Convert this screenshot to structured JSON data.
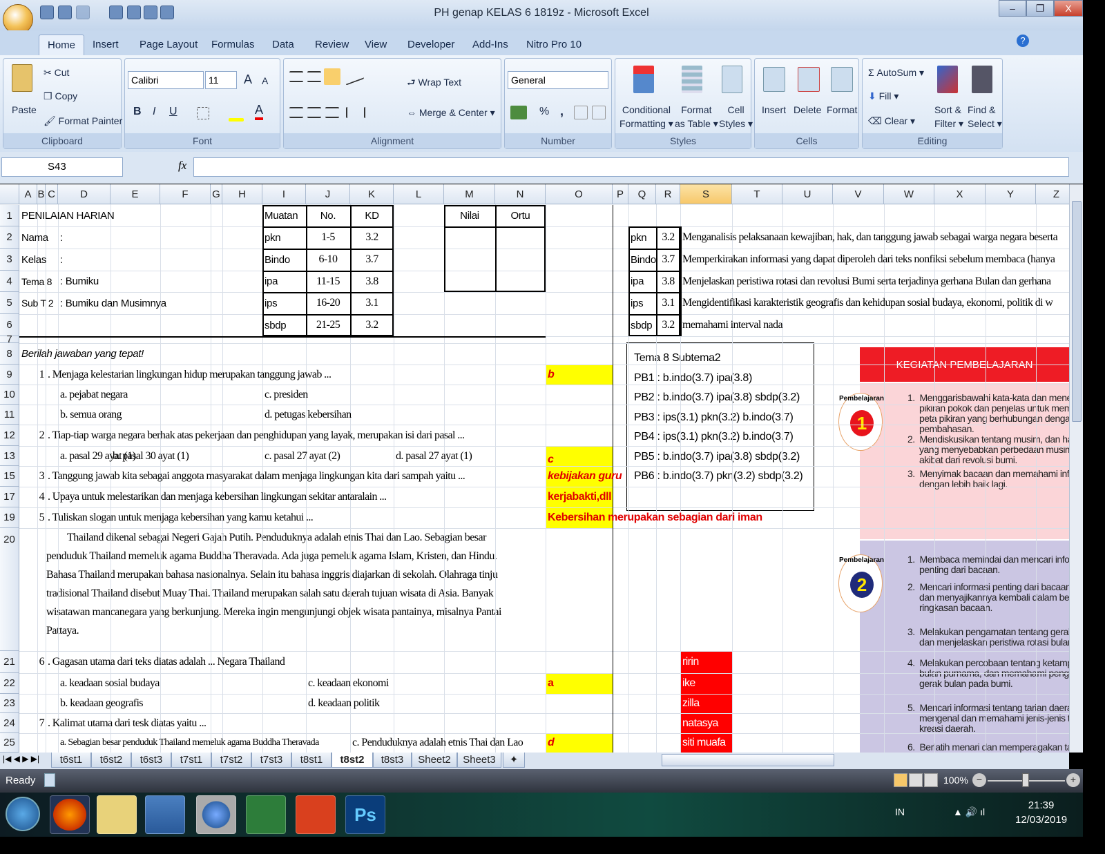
{
  "window": {
    "title": "PH genap KELAS 6 1819z - Microsoft Excel",
    "controls": [
      "–",
      "❐",
      "X"
    ]
  },
  "tabs": [
    {
      "label": "Home",
      "active": true
    },
    {
      "label": "Insert"
    },
    {
      "label": "Page Layout"
    },
    {
      "label": "Formulas"
    },
    {
      "label": "Data"
    },
    {
      "label": "Review"
    },
    {
      "label": "View"
    },
    {
      "label": "Developer"
    },
    {
      "label": "Add-Ins"
    },
    {
      "label": "Nitro Pro 10"
    }
  ],
  "ribbon": {
    "clipboard": {
      "label": "Clipboard",
      "paste": "Paste",
      "cut": "Cut",
      "copy": "Copy",
      "format_painter": "Format Painter"
    },
    "font": {
      "label": "Font",
      "name": "Calibri",
      "size": "11",
      "bold": "B",
      "italic": "I",
      "underline": "U",
      "grow": "A",
      "shrink": "A",
      "color": "A"
    },
    "alignment": {
      "label": "Alignment",
      "wrap": "Wrap Text",
      "merge": "Merge & Center"
    },
    "number": {
      "label": "Number",
      "format": "General",
      "percent": "%",
      "comma": ","
    },
    "styles": {
      "label": "Styles",
      "conditional": "Conditional",
      "conditional2": "Formatting",
      "format_table": "Format",
      "format_table2": "as Table",
      "cell_styles": "Cell",
      "cell_styles2": "Styles"
    },
    "cells": {
      "label": "Cells",
      "insert": "Insert",
      "delete": "Delete",
      "format": "Format"
    },
    "editing": {
      "label": "Editing",
      "autosum": "AutoSum",
      "fill": "Fill",
      "clear": "Clear",
      "sort": "Sort &",
      "sort2": "Filter",
      "find": "Find &",
      "find2": "Select"
    }
  },
  "formula_bar": {
    "name_box": "S43",
    "fx": "fx",
    "value": ""
  },
  "columns": [
    "A",
    "B",
    "C",
    "D",
    "E",
    "F",
    "G",
    "H",
    "I",
    "J",
    "K",
    "L",
    "M",
    "N",
    "O",
    "P",
    "Q",
    "R",
    "S",
    "T",
    "U",
    "V",
    "W",
    "X",
    "Y",
    "Z"
  ],
  "selected_column": "S",
  "rows": [
    "1",
    "2",
    "3",
    "4",
    "5",
    "6",
    "7",
    "8",
    "9",
    "10",
    "11",
    "12",
    "13",
    "15",
    "17",
    "19",
    "20",
    "21",
    "22",
    "23",
    "24",
    "25"
  ],
  "cells": [
    {
      "c": "A",
      "r": "1",
      "v": "PENILAIAN HARIAN",
      "s": "sans"
    },
    {
      "c": "I",
      "r": "1",
      "v": "Muatan",
      "s": "sans"
    },
    {
      "c": "J",
      "r": "1",
      "v": "No.",
      "s": "sans center"
    },
    {
      "c": "K",
      "r": "1",
      "v": "KD",
      "s": "sans center"
    },
    {
      "c": "M",
      "r": "1",
      "v": "Nilai",
      "s": "sans center"
    },
    {
      "c": "N",
      "r": "1",
      "v": "Ortu",
      "s": "sans center"
    },
    {
      "c": "A",
      "r": "2",
      "v": "Nama",
      "s": "sans"
    },
    {
      "c": "D",
      "r": "2",
      "v": ":",
      "s": "sans"
    },
    {
      "c": "I",
      "r": "2",
      "v": "pkn",
      "s": "sans"
    },
    {
      "c": "J",
      "r": "2",
      "v": "1-5",
      "s": "center"
    },
    {
      "c": "K",
      "r": "2",
      "v": "3.2",
      "s": "center"
    },
    {
      "c": "Q",
      "r": "2",
      "v": "pkn",
      "s": "sans"
    },
    {
      "c": "R",
      "r": "2",
      "v": "3.2",
      "s": "center"
    },
    {
      "c": "S",
      "r": "2",
      "v": "Menganalisis pelaksanaan kewajiban, hak, dan tanggung jawab sebagai warga negara beserta"
    },
    {
      "c": "A",
      "r": "3",
      "v": "Kelas",
      "s": "sans"
    },
    {
      "c": "D",
      "r": "3",
      "v": ":",
      "s": "sans"
    },
    {
      "c": "I",
      "r": "3",
      "v": "Bindo",
      "s": "sans"
    },
    {
      "c": "J",
      "r": "3",
      "v": "6-10",
      "s": "center"
    },
    {
      "c": "K",
      "r": "3",
      "v": "3.7",
      "s": "center"
    },
    {
      "c": "Q",
      "r": "3",
      "v": "Bindo",
      "s": "sans clip"
    },
    {
      "c": "R",
      "r": "3",
      "v": "3.7",
      "s": "center"
    },
    {
      "c": "S",
      "r": "3",
      "v": "Memperkirakan informasi yang dapat diperoleh dari teks nonfiksi sebelum membaca (hanya"
    },
    {
      "c": "A",
      "r": "4",
      "v": "Tema 8",
      "s": "sans small"
    },
    {
      "c": "D",
      "r": "4",
      "v": ": Bumiku",
      "s": "sans"
    },
    {
      "c": "I",
      "r": "4",
      "v": "ipa",
      "s": "sans"
    },
    {
      "c": "J",
      "r": "4",
      "v": "11-15",
      "s": "center"
    },
    {
      "c": "K",
      "r": "4",
      "v": "3.8",
      "s": "center"
    },
    {
      "c": "Q",
      "r": "4",
      "v": "ipa",
      "s": "sans"
    },
    {
      "c": "R",
      "r": "4",
      "v": "3.8",
      "s": "center"
    },
    {
      "c": "S",
      "r": "4",
      "v": "Menjelaskan peristiwa rotasi dan revolusi Bumi serta terjadinya gerhana Bulan dan gerhana"
    },
    {
      "c": "A",
      "r": "5",
      "v": "Sub T 2",
      "s": "sans small"
    },
    {
      "c": "D",
      "r": "5",
      "v": ": Bumiku dan Musimnya",
      "s": "sans"
    },
    {
      "c": "I",
      "r": "5",
      "v": "ips",
      "s": "sans"
    },
    {
      "c": "J",
      "r": "5",
      "v": "16-20",
      "s": "center"
    },
    {
      "c": "K",
      "r": "5",
      "v": "3.1",
      "s": "center"
    },
    {
      "c": "Q",
      "r": "5",
      "v": "ips",
      "s": "sans"
    },
    {
      "c": "R",
      "r": "5",
      "v": "3.1",
      "s": "center"
    },
    {
      "c": "S",
      "r": "5",
      "v": "Mengidentifikasi karakteristik geografis dan kehidupan sosial budaya, ekonomi, politik di w"
    },
    {
      "c": "I",
      "r": "6",
      "v": "sbdp",
      "s": "sans"
    },
    {
      "c": "J",
      "r": "6",
      "v": "21-25",
      "s": "center"
    },
    {
      "c": "K",
      "r": "6",
      "v": "3.2",
      "s": "center"
    },
    {
      "c": "Q",
      "r": "6",
      "v": "sbdp",
      "s": "sans"
    },
    {
      "c": "R",
      "r": "6",
      "v": "3.2",
      "s": "center"
    },
    {
      "c": "S",
      "r": "6",
      "v": "memahami interval nada"
    },
    {
      "c": "A",
      "r": "8",
      "v": "Berilah jawaban yang tepat!",
      "s": "sans ital"
    },
    {
      "c": "B",
      "r": "9",
      "v": "1",
      "s": "right"
    },
    {
      "c": "C",
      "r": "9",
      "v": ". Menjaga kelestarian lingkungan hidup merupakan tanggung jawab ..."
    },
    {
      "c": "O",
      "r": "9",
      "v": "b",
      "s": "ans ital"
    },
    {
      "c": "D",
      "r": "10",
      "v": "a. pejabat negara"
    },
    {
      "c": "I",
      "r": "10",
      "v": "c. presiden"
    },
    {
      "c": "D",
      "r": "11",
      "v": "b. semua orang"
    },
    {
      "c": "I",
      "r": "11",
      "v": "d. petugas kebersihan"
    },
    {
      "c": "B",
      "r": "12",
      "v": "2",
      "s": "right"
    },
    {
      "c": "C",
      "r": "12",
      "v": ". Tiap-tiap warga negara berhak atas pekerjaan dan penghidupan yang layak, merupakan isi dari pasal ..."
    },
    {
      "c": "D",
      "r": "13",
      "v": "a. pasal 29 ayat (1)"
    },
    {
      "c": "E",
      "r": "13",
      "v": "b. pasal 30 ayat (1)"
    },
    {
      "c": "I",
      "r": "13",
      "v": "c. pasal 27 ayat (2)"
    },
    {
      "c": "L",
      "r": "13",
      "v": "d. pasal 27 ayat (1)"
    },
    {
      "c": "O",
      "r": "13",
      "v": "c",
      "s": "ans ital low"
    },
    {
      "c": "B",
      "r": "15",
      "v": "3",
      "s": "right"
    },
    {
      "c": "C",
      "r": "15",
      "v": ". Tanggung jawab kita sebagai anggota masyarakat dalam menjaga lingkungan kita dari sampah yaitu ..."
    },
    {
      "c": "O",
      "r": "15",
      "v": "kebijakan guru",
      "s": "ans ital"
    },
    {
      "c": "B",
      "r": "17",
      "v": "4",
      "s": "right"
    },
    {
      "c": "C",
      "r": "17",
      "v": ". Upaya untuk melestarikan dan menjaga kebersihan lingkungan sekitar antaralain ..."
    },
    {
      "c": "O",
      "r": "17",
      "v": "kerjabakti,dll",
      "s": "ans"
    },
    {
      "c": "B",
      "r": "19",
      "v": "5",
      "s": "right"
    },
    {
      "c": "C",
      "r": "19",
      "v": ". Tuliskan slogan untuk menjaga kebersihan yang kamu ketahui ..."
    },
    {
      "c": "O",
      "r": "19",
      "v": "Kebersihan merupakan sebagian dari iman",
      "s": "ans"
    },
    {
      "c": "A",
      "r": "20",
      "v": "20",
      "s": "hidden"
    },
    {
      "c": "B",
      "r": "21",
      "v": "6",
      "s": "right"
    },
    {
      "c": "C",
      "r": "21",
      "v": ". Gagasan utama dari teks diatas adalah ...  Negara Thailand"
    },
    {
      "c": "S",
      "r": "21",
      "v": "ririn",
      "s": "white"
    },
    {
      "c": "D",
      "r": "22",
      "v": "a. keadaan sosial budaya"
    },
    {
      "c": "J",
      "r": "22",
      "v": "c. keadaan ekonomi"
    },
    {
      "c": "O",
      "r": "22",
      "v": "a",
      "s": "ans"
    },
    {
      "c": "S",
      "r": "22",
      "v": "ike",
      "s": "white"
    },
    {
      "c": "D",
      "r": "23",
      "v": "b. keadaan geografis"
    },
    {
      "c": "J",
      "r": "23",
      "v": "d. keadaan politik"
    },
    {
      "c": "S",
      "r": "23",
      "v": "zilla",
      "s": "white"
    },
    {
      "c": "B",
      "r": "24",
      "v": "7",
      "s": "right"
    },
    {
      "c": "C",
      "r": "24",
      "v": ". Kalimat utama dari tesk diatas yaitu ..."
    },
    {
      "c": "S",
      "r": "24",
      "v": "natasya",
      "s": "white"
    },
    {
      "c": "D",
      "r": "25",
      "v": "a. Sebagian besar penduduk Thailand  memeluk agama Buddha Theravada",
      "s": "tiny"
    },
    {
      "c": "K",
      "r": "25",
      "v": "c. Penduduknya adalah etnis Thai  dan  Lao"
    },
    {
      "c": "O",
      "r": "25",
      "v": "d",
      "s": "ans ital"
    },
    {
      "c": "S",
      "r": "25",
      "v": "siti muafa",
      "s": "white"
    }
  ],
  "reading_passage": "Thailand  dikenal sebagai Negeri Gajah Putih.  Penduduknya adalah etnis Thai  dan  Lao. Sebagian besar penduduk Thailand  memeluk agama Buddha Theravada. Ada  juga  pemeluk agama Islam, Kristen, dan Hindu. Bahasa Thailand merupakan bahasa nasionalnya. Selain itu bahasa inggris diajarkan di sekolah. Olahraga tinju tradisional Thailand disebut Muay Thai. Thailand merupakan salah satu daerah tujuan wisata di Asia. Banyak wisatawan mancanegara yang berkunjung. Mereka ingin mengunjungi objek wisata pantainya, misalnya Pantai Pattaya.",
  "text_box": [
    "Tema 8 Subtema2",
    "PB1 : b.indo(3.7) ipa(3.8)",
    "PB2 : b.indo(3.7) ipa(3.8)  sbdp(3.2)",
    "PB3 : ips(3.1) pkn(3.2) b.indo(3.7)",
    "PB4 : ips(3.1) pkn(3.2) b.indo(3.7)",
    "PB5 : b.indo(3.7) ipa(3.8)  sbdp(3.2)",
    "PB6 : b.indo(3.7) pkn(3.2) sbdp(3.2)"
  ],
  "image_panel": {
    "header": "KEGIATAN PEMBELAJARAN",
    "badge_word": "Pembelajaran",
    "section1": {
      "number": "1",
      "items": [
        "1.  Menggarisbawahi kata-kata dan menen\n     pikiran pokok dan penjelas untuk memb\n     peta pikiran yang berhubungan dengan\n     pembahasan.",
        "2.  Mendiskusikan tentang musim, dan hal-\n     yang menyebabkan perbedaan musim s\n     akibat dari revolusi bumi.",
        "3.  Menyimak bacaan dan memahami infor\n     dengan lebih baik lagi."
      ]
    },
    "section2": {
      "number": "2",
      "items": [
        "1.  Membaca memindai dan mencari inform\n     penting dari bacaan.",
        "2.  Mencari informasi penting dari bacaan,\n     dan menyajikannya kembali dalam bent\n     ringkasan bacaan.",
        "3.  Melakukan pengamatan tentang gerak b\n     dan menjelaskan peristiwa rotasi bulan.",
        "4.  Melakukan percobaan tentang ketampak\n     bulan purnama, dan memahami pengar\n     gerak bulan pada bumi.",
        "5.  Mencari informasi tentang tarian daerah\n     mengenal dan memahami jenis-jenis ta\n     kreasi daerah.",
        "6.  Berlatih menari dan memperagakan tar"
      ]
    },
    "colors": {
      "header": "#ee1c25",
      "section1_bg": "#fbd5d8",
      "section2_bg": "#cbc6e3",
      "badge1": "#e8141c",
      "badge2": "#1f2b7a"
    }
  },
  "sheet_tabs": [
    {
      "label": "t6st1"
    },
    {
      "label": "t6st2"
    },
    {
      "label": "t6st3"
    },
    {
      "label": "t7st1"
    },
    {
      "label": "t7st2"
    },
    {
      "label": "t7st3"
    },
    {
      "label": "t8st1"
    },
    {
      "label": "t8st2",
      "active": true
    },
    {
      "label": "t8st3"
    },
    {
      "label": "Sheet2"
    },
    {
      "label": "Sheet3"
    }
  ],
  "status": {
    "ready": "Ready",
    "zoom": "100%"
  },
  "taskbar": {
    "apps": [
      "windows-start",
      "firefox",
      "file-explorer",
      "media-player",
      "chrome",
      "excel",
      "nitro-pdf",
      "photoshop"
    ],
    "lang": "IN",
    "time": "21:39",
    "date": "12/03/2019"
  },
  "colors": {
    "answer_fill": "#ffff00",
    "answer_text": "#e00000",
    "names_fill": "#ff0000",
    "selected_col": "#f7c86a"
  }
}
